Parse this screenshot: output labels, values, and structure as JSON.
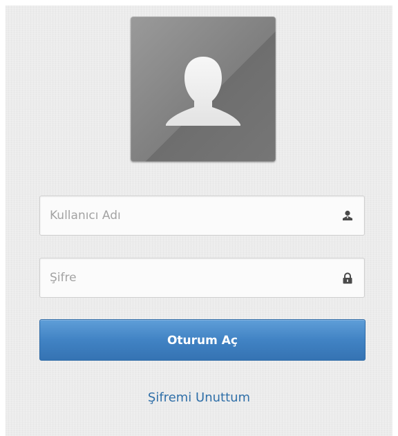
{
  "login": {
    "username_placeholder": "Kullanıcı Adı",
    "password_placeholder": "Şifre",
    "submit_label": "Oturum Aç",
    "forgot_label": "Şifremi Unuttum"
  },
  "icons": {
    "avatar": "user-silhouette-icon",
    "username": "user-icon",
    "password": "lock-icon"
  },
  "colors": {
    "button": "#4183c4",
    "link": "#2f6fa8",
    "background": "#ececec"
  }
}
